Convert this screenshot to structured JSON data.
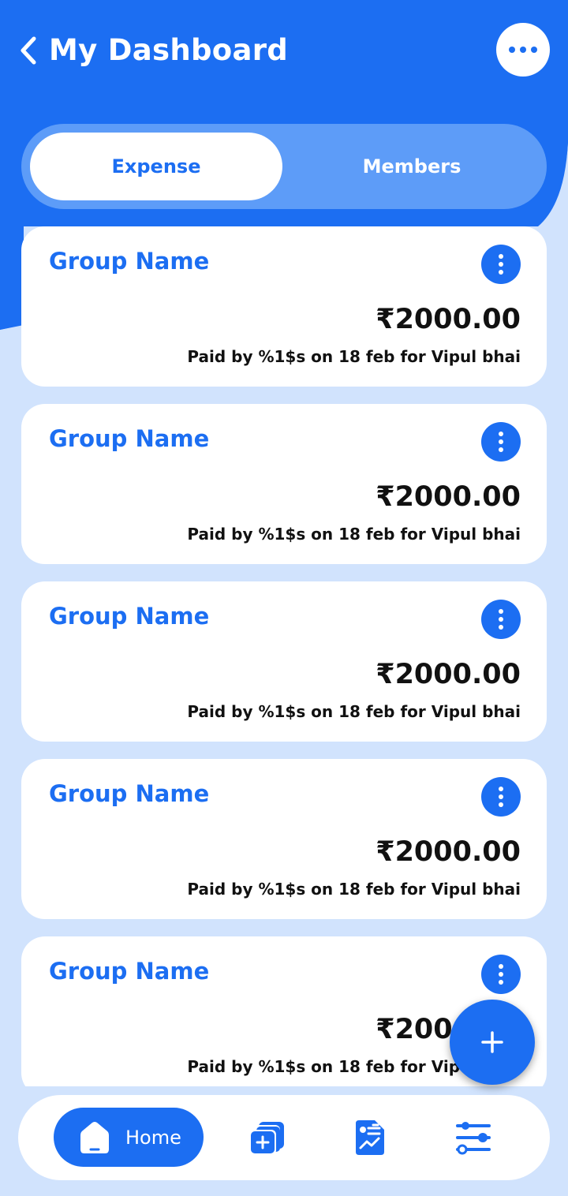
{
  "header": {
    "title": "My Dashboard",
    "back_icon": "chevron-left-icon",
    "menu_icon": "more-horizontal-icon"
  },
  "tabs": [
    {
      "label": "Expense",
      "active": true
    },
    {
      "label": "Members",
      "active": false
    }
  ],
  "expenses": [
    {
      "group": "Group Name",
      "amount": "₹2000.00",
      "details": "Paid by %1$s on 18 feb for Vipul bhai"
    },
    {
      "group": "Group Name",
      "amount": "₹2000.00",
      "details": "Paid by %1$s on 18 feb for Vipul bhai"
    },
    {
      "group": "Group Name",
      "amount": "₹2000.00",
      "details": "Paid by %1$s on 18 feb for Vipul bhai"
    },
    {
      "group": "Group Name",
      "amount": "₹2000.00",
      "details": "Paid by %1$s on 18 feb for Vipul bhai"
    },
    {
      "group": "Group Name",
      "amount": "₹2000.00",
      "details": "Paid by %1$s on 18 feb for Vipul bhai"
    }
  ],
  "fab": {
    "label": "+",
    "icon": "plus-icon"
  },
  "bottom_nav": {
    "home_label": "Home",
    "items": [
      "home-icon",
      "add-group-icon",
      "reports-icon",
      "settings-sliders-icon"
    ]
  },
  "colors": {
    "primary": "#1c6ef2",
    "background": "#d1e3fd",
    "tab_track": "#5d9cf8",
    "card": "#ffffff",
    "text_dark": "#111111"
  }
}
